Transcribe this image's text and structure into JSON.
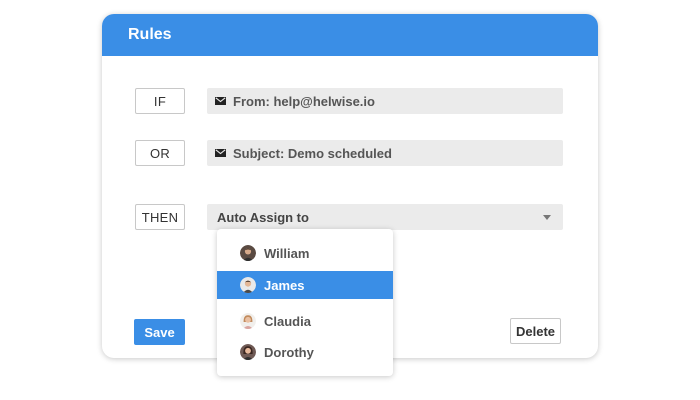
{
  "card": {
    "title": "Rules"
  },
  "rules": {
    "if_label": "IF",
    "or_label": "OR",
    "then_label": "THEN",
    "condition_from": "From: help@helwise.io",
    "condition_subject": "Subject: Demo scheduled",
    "action_select": "Auto Assign to"
  },
  "buttons": {
    "save": "Save",
    "delete": "Delete"
  },
  "dropdown": {
    "items": [
      {
        "label": "William",
        "selected": false
      },
      {
        "label": "James",
        "selected": true
      },
      {
        "label": "Claudia",
        "selected": false
      },
      {
        "label": "Dorothy",
        "selected": false
      }
    ]
  },
  "colors": {
    "accent": "#3a8ee6",
    "field_bg": "#ebebeb",
    "text": "#555555"
  },
  "icons": {
    "condition": "mail-icon",
    "select": "caret-down-icon"
  }
}
